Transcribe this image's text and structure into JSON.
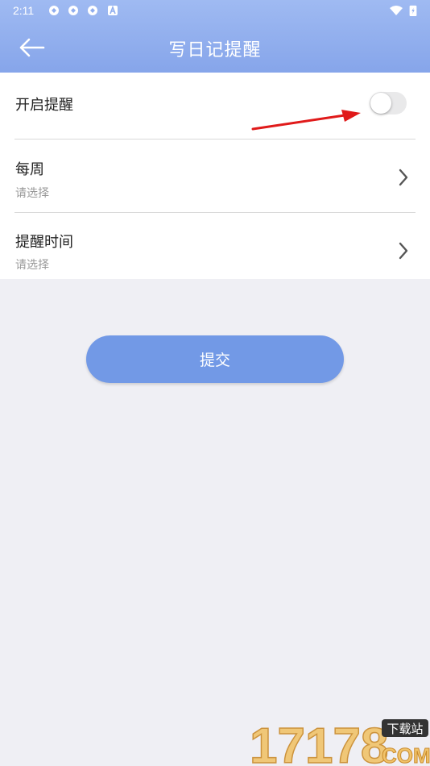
{
  "status_bar": {
    "time": "2:11",
    "icons": [
      "sync-icon",
      "sync-icon",
      "sync-icon",
      "app-a-icon",
      "wifi-icon",
      "battery-charging-icon"
    ]
  },
  "header": {
    "title": "写日记提醒",
    "back_icon": "back-arrow-icon"
  },
  "settings": {
    "enable_reminder": {
      "label": "开启提醒",
      "enabled": false
    },
    "weekly": {
      "label": "每周",
      "value_placeholder": "请选择"
    },
    "reminder_time": {
      "label": "提醒时间",
      "value_placeholder": "请选择"
    }
  },
  "submit": {
    "label": "提交"
  },
  "colors": {
    "header": "#86a5ea",
    "accent": "#7299e6",
    "background": "#efeff4",
    "annotation_arrow": "#e01a1a"
  },
  "watermark": {
    "text": "17178",
    "tag": "下载站",
    "domain": "COM"
  }
}
